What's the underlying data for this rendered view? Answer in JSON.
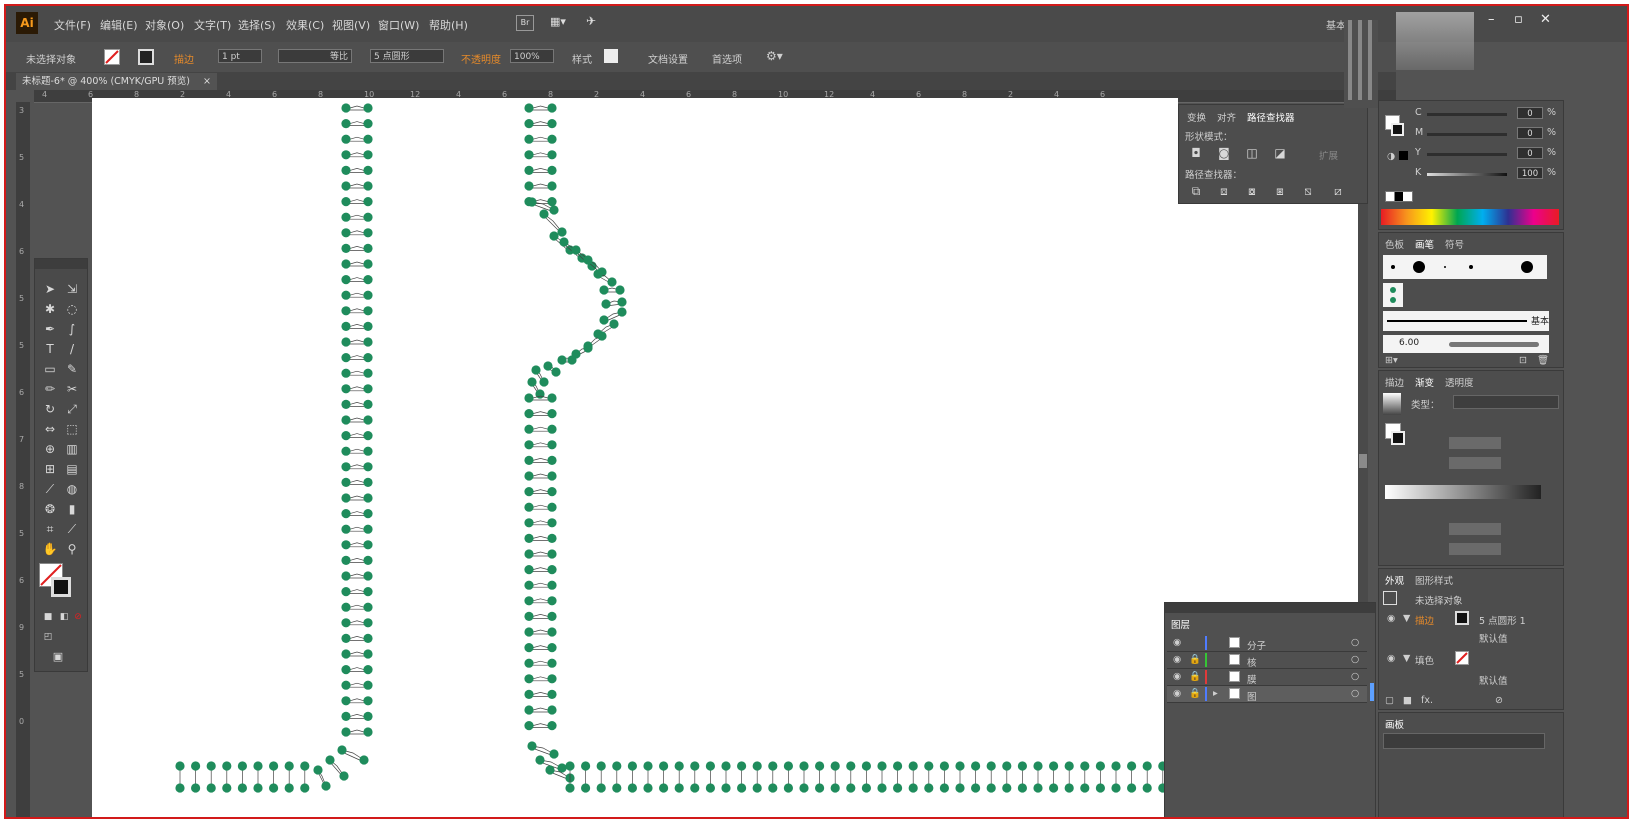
{
  "app": {
    "logo": "Ai",
    "title_right": "基本功能"
  },
  "menu": [
    "文件(F)",
    "编辑(E)",
    "对象(O)",
    "文字(T)",
    "选择(S)",
    "效果(C)",
    "视图(V)",
    "窗口(W)",
    "帮助(H)"
  ],
  "menu_icons": {
    "bridge": "Br",
    "arrange": "arrange-icon",
    "spark": "gpu-icon"
  },
  "window_buttons": {
    "minimize": "–",
    "restore": "▫",
    "close": "✕"
  },
  "control": {
    "selection": "未选择对象",
    "stroke_label": "描边",
    "stroke_width": "1 pt",
    "profile": "等比",
    "brush": "5 点圆形",
    "opacity_label": "不透明度",
    "opacity_value": "100%",
    "style_label": "样式",
    "doc_setup": "文档设置",
    "preferences": "首选项"
  },
  "document_tab": {
    "title": "未标题-6* @ 400% (CMYK/GPU 预览)",
    "close": "×"
  },
  "ruler_labels": {
    "horizontal": [
      "4",
      "6",
      "8",
      "2",
      "4",
      "6",
      "8",
      "10",
      "12",
      "4",
      "6",
      "8",
      "2",
      "4",
      "6",
      "8",
      "10",
      "12",
      "4",
      "6",
      "8",
      "2",
      "4",
      "6"
    ],
    "vertical": [
      "3",
      "5",
      "4",
      "6",
      "5",
      "5",
      "6",
      "7",
      "8",
      "5",
      "6",
      "9",
      "5",
      "0"
    ]
  },
  "pathfinder": {
    "tabs": [
      "变换",
      "对齐",
      "路径查找器"
    ],
    "shape_modes_label": "形状模式：",
    "expand_label": "扩展",
    "pathfinders_label": "路径查找器："
  },
  "color": {
    "channels": [
      {
        "name": "C",
        "value": "0",
        "suffix": "%"
      },
      {
        "name": "M",
        "value": "0",
        "suffix": "%"
      },
      {
        "name": "Y",
        "value": "0",
        "suffix": "%"
      },
      {
        "name": "K",
        "value": "100",
        "suffix": "%"
      }
    ]
  },
  "brushes": {
    "tabs": [
      "色板",
      "画笔",
      "符号"
    ],
    "basic_label": "基本",
    "size": "6.00"
  },
  "stroke_panel": {
    "tabs": [
      "描边",
      "渐变",
      "透明度"
    ],
    "type_label": "类型："
  },
  "appearance": {
    "tabs": [
      "外观",
      "图形样式"
    ],
    "no_selection": "未选择对象",
    "stroke_label": "描边",
    "stroke_value": "5 点圆形 1",
    "default_label": "默认值",
    "fill_label": "填色",
    "default_label_2": "默认值",
    "fx_label": "fx."
  },
  "layers": {
    "title": "图层",
    "items": [
      {
        "name": "分子",
        "color": "#4f7cff"
      },
      {
        "name": "核",
        "color": "#35c635"
      },
      {
        "name": "膜",
        "color": "#e03a3a"
      },
      {
        "name": "图",
        "color": "#4f7cff"
      }
    ]
  },
  "bottom_panel": {
    "tab": "画板"
  },
  "colors": {
    "accent": "#1f8c5c",
    "canvas": "#ffffff",
    "ui": "#535353",
    "frame": "#d21a1a"
  }
}
